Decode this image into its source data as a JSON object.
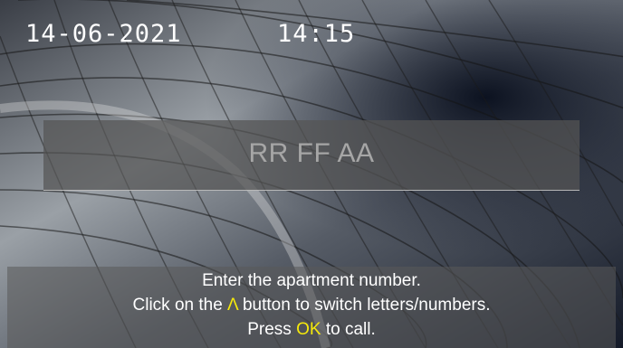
{
  "status_bar": {
    "date": "14-06-2021",
    "time": "14:15"
  },
  "entry": {
    "value": "RR FF AA"
  },
  "instructions": {
    "line1": "Enter the apartment number.",
    "line2_prefix": "Click on the ",
    "line2_key": "Λ",
    "line2_suffix": " button to switch letters/numbers.",
    "line3_prefix": "Press ",
    "line3_key": "OK",
    "line3_suffix": " to call."
  },
  "colors": {
    "highlight": "#f5e90b",
    "text": "#ffffff",
    "entry_text": "#a6a6a6"
  }
}
